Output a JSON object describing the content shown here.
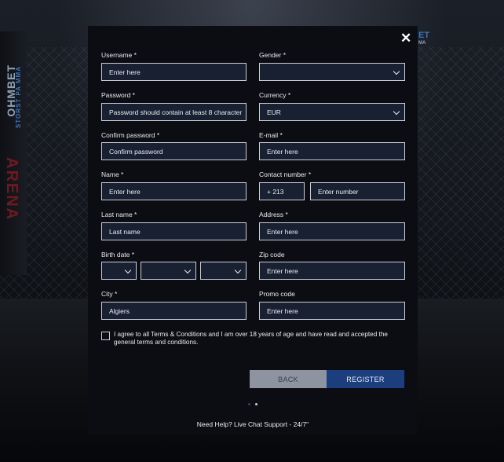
{
  "background": {
    "brand_left": "OHMBET",
    "brand_left_sub": "STORST PA MMA",
    "arena": "ARENA",
    "brand_right_top": "ET",
    "brand_right_sub": "MA"
  },
  "form": {
    "close_icon": "close-icon",
    "close_symbol": "✕",
    "username": {
      "label": "Username *",
      "placeholder": "Enter here"
    },
    "gender": {
      "label": "Gender *",
      "value": ""
    },
    "password": {
      "label": "Password *",
      "placeholder": "Password should contain at least 8 character"
    },
    "currency": {
      "label": "Currency *",
      "value": "EUR"
    },
    "confirm_password": {
      "label": "Confirm password *",
      "placeholder": "Confirm password"
    },
    "email": {
      "label": "E-mail *",
      "placeholder": "Enter here"
    },
    "name": {
      "label": "Name *",
      "placeholder": "Enter here"
    },
    "contact_number": {
      "label": "Contact number *",
      "code": "+ 213",
      "placeholder": "Enter number"
    },
    "last_name": {
      "label": "Last name *",
      "placeholder": "Last name"
    },
    "address": {
      "label": "Address *",
      "placeholder": "Enter here"
    },
    "birth_date": {
      "label": "Birth date *",
      "day": "",
      "month": "",
      "year": ""
    },
    "zip_code": {
      "label": "Zip code",
      "placeholder": "Enter here"
    },
    "city": {
      "label": "City *",
      "value": "Algiers"
    },
    "promo_code": {
      "label": "Promo code",
      "placeholder": "Enter here"
    },
    "terms": "I agree to all Terms & Conditions and I am over 18 years of age and have read and accepted the general terms and conditions.",
    "back_label": "BACK",
    "register_label": "REGISTER",
    "help_text": "Need Help? Live Chat Support - 24/7\""
  },
  "colors": {
    "field_bg": "#182032",
    "field_border": "#c9ced8",
    "register_bg": "#1d3e7d",
    "back_bg": "#8d939f"
  }
}
